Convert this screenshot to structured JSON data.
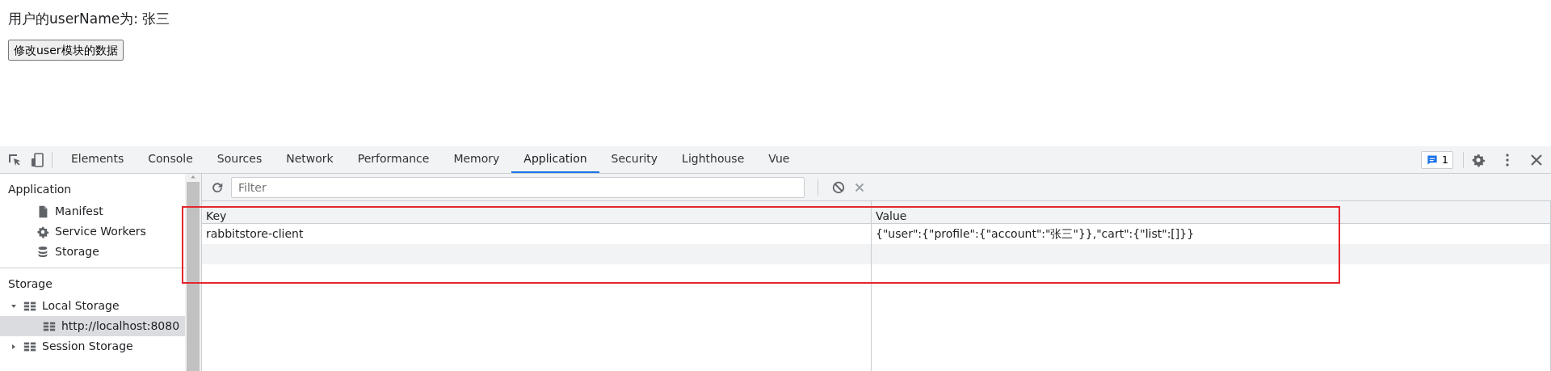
{
  "page": {
    "heading": "用户的userName为: 张三",
    "button": "修改user模块的数据"
  },
  "devtools": {
    "tabs": [
      {
        "label": "Elements",
        "selected": false
      },
      {
        "label": "Console",
        "selected": false
      },
      {
        "label": "Sources",
        "selected": false
      },
      {
        "label": "Network",
        "selected": false
      },
      {
        "label": "Performance",
        "selected": false
      },
      {
        "label": "Memory",
        "selected": false
      },
      {
        "label": "Application",
        "selected": true
      },
      {
        "label": "Security",
        "selected": false
      },
      {
        "label": "Lighthouse",
        "selected": false
      },
      {
        "label": "Vue",
        "selected": false
      }
    ],
    "issues_count": "1",
    "sidebar": [
      {
        "title": "Application",
        "items": [
          {
            "label": "Manifest",
            "selected": false
          },
          {
            "label": "Service Workers",
            "selected": false
          },
          {
            "label": "Storage",
            "selected": false
          }
        ]
      },
      {
        "title": "Storage",
        "items": [
          {
            "label": "Local Storage",
            "selected": false,
            "expanded": true,
            "children": [
              {
                "label": "http://localhost:8080",
                "selected": true
              }
            ]
          },
          {
            "label": "Session Storage",
            "selected": false,
            "expanded": false
          }
        ]
      }
    ],
    "filter": {
      "placeholder": "Filter"
    },
    "table": {
      "columns": [
        "Key",
        "Value"
      ],
      "rows": [
        {
          "key": "rabbitstore-client",
          "value": "{\"user\":{\"profile\":{\"account\":\"张三\"}},\"cart\":{\"list\":[]}}"
        }
      ]
    }
  }
}
